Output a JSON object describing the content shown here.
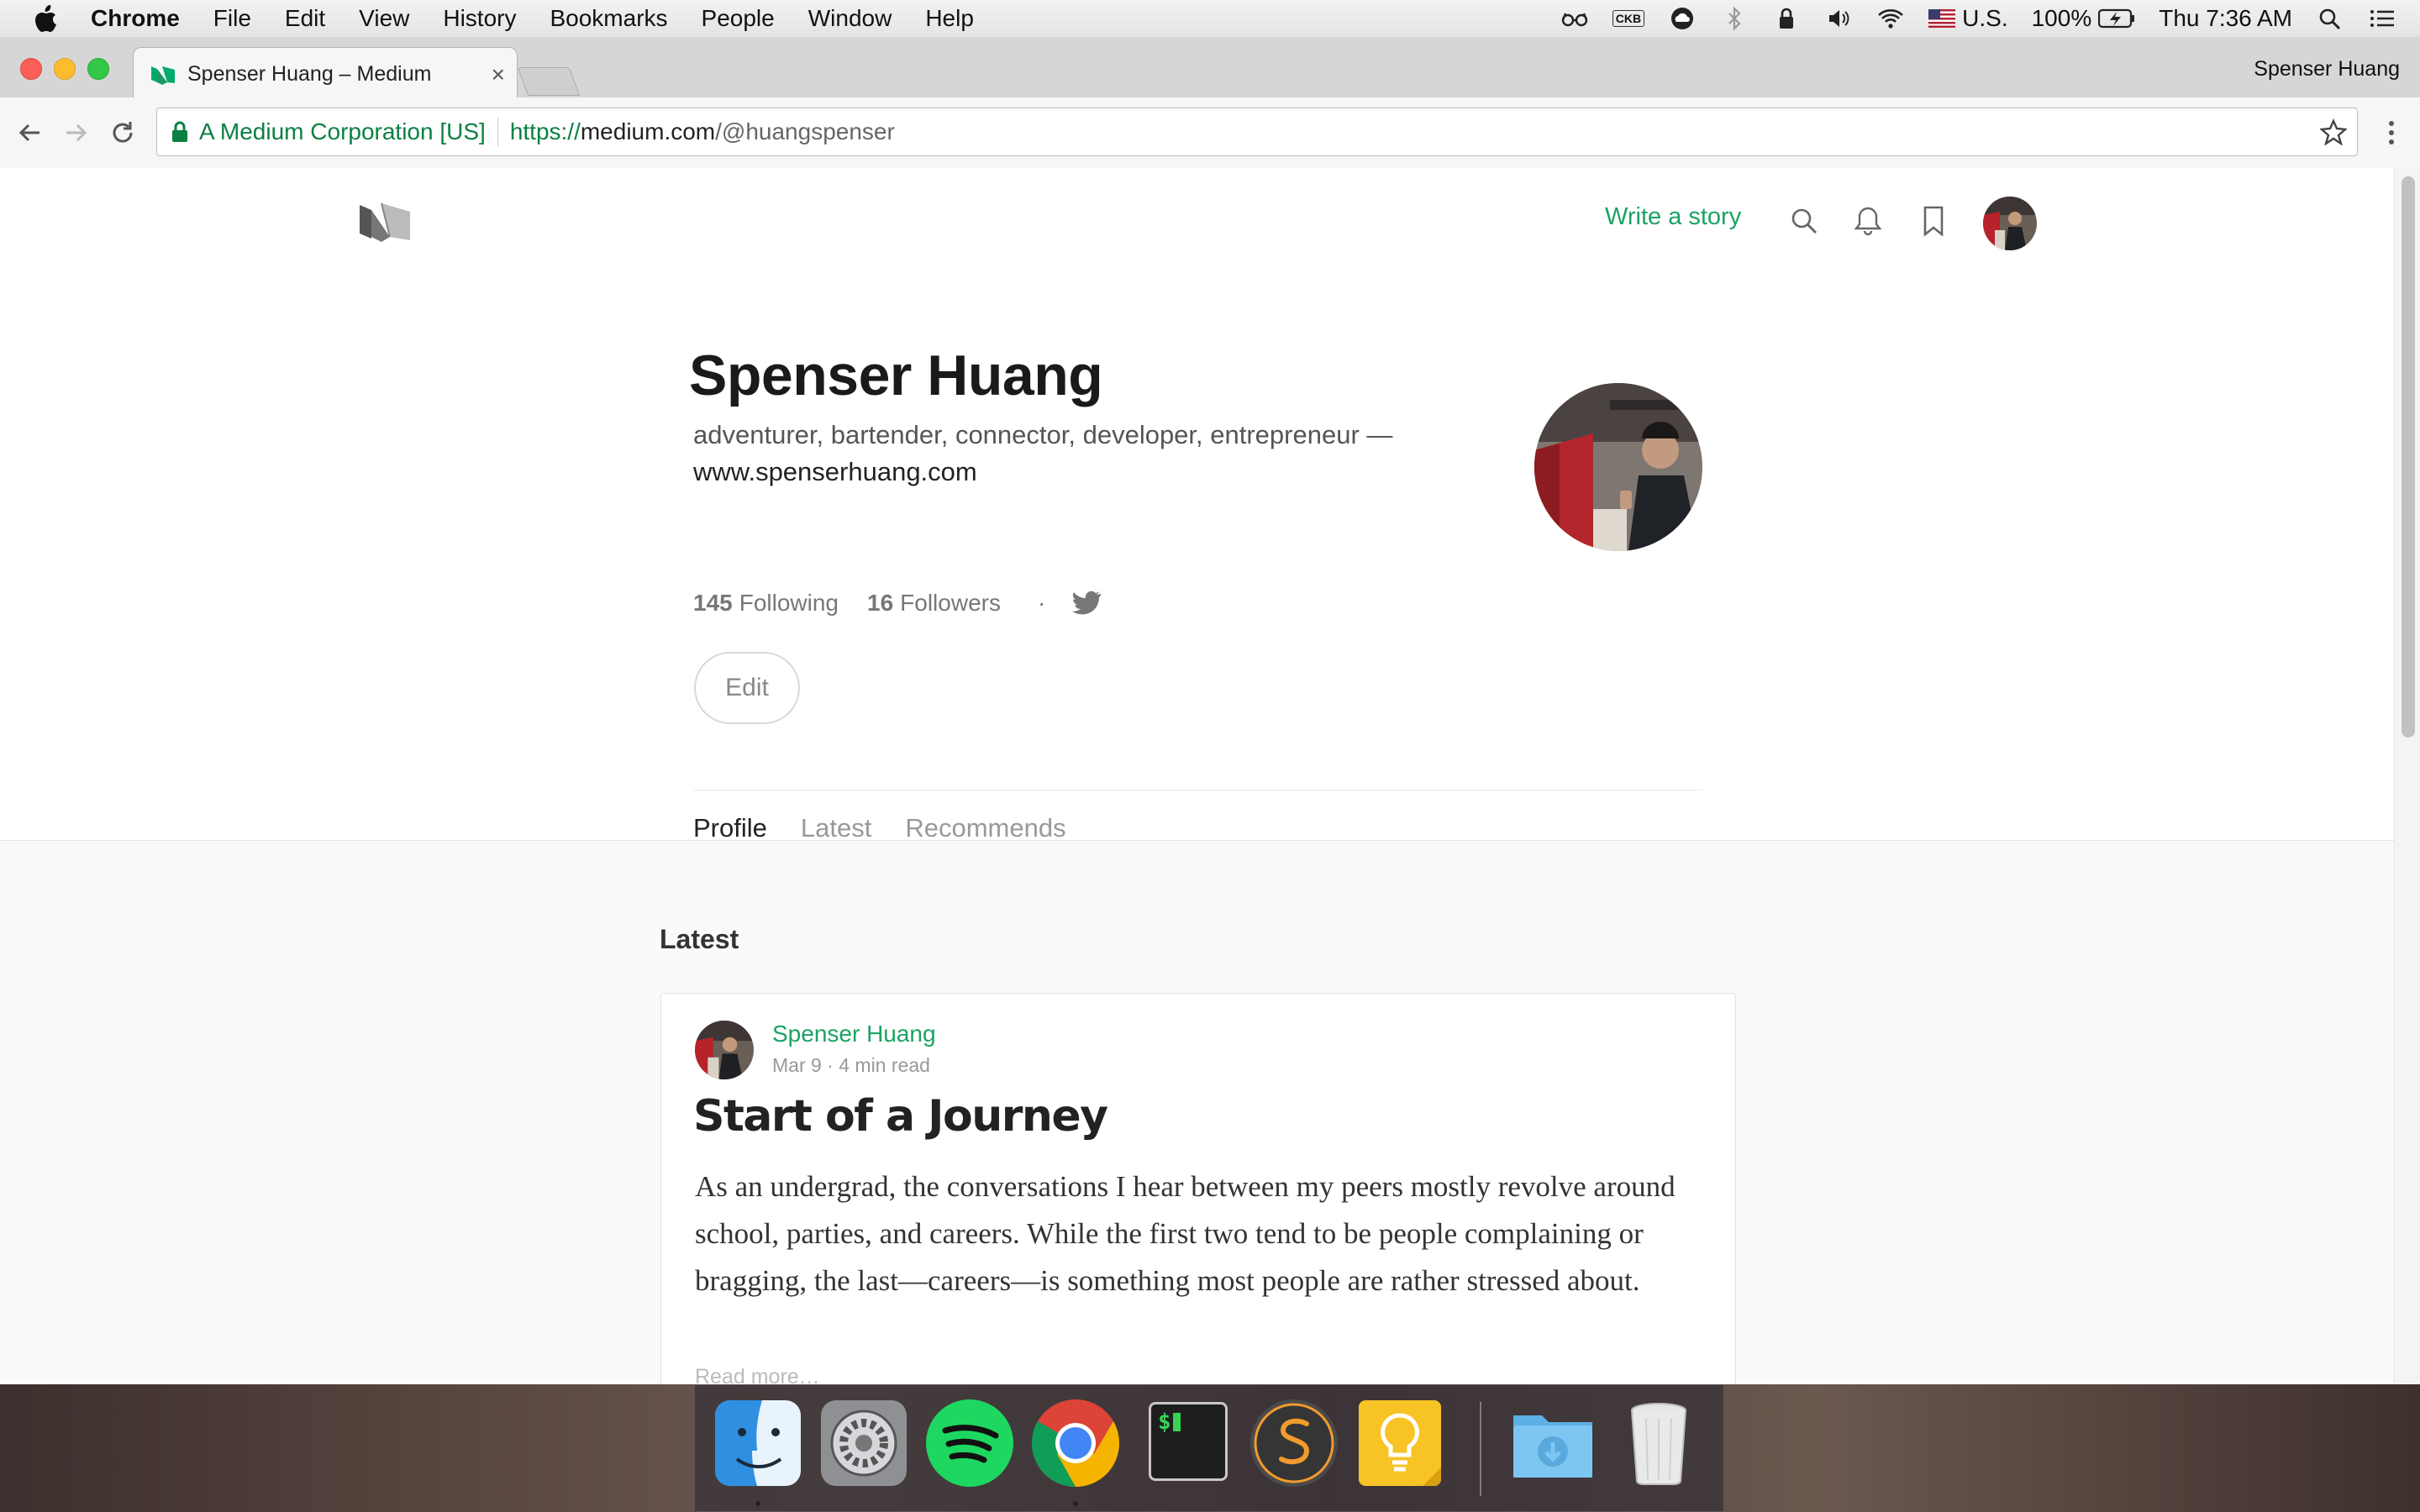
{
  "menubar": {
    "app": "Chrome",
    "items": [
      "File",
      "Edit",
      "View",
      "History",
      "Bookmarks",
      "People",
      "Window",
      "Help"
    ],
    "status": {
      "input_source_badge": "CKB",
      "keyboard_region": "U.S.",
      "battery": "100%",
      "clock": "Thu 7:36 AM"
    }
  },
  "browser": {
    "tab_title": "Spenser Huang – Medium",
    "tab_close": "×",
    "profile_name": "Spenser Huang",
    "omnibox": {
      "org": "A Medium Corporation [US]",
      "scheme": "https://",
      "host": "medium.com",
      "path": "/@huangspenser"
    }
  },
  "page": {
    "header": {
      "write_story": "Write a story"
    },
    "profile": {
      "name": "Spenser Huang",
      "bio": "adventurer, bartender, connector, developer, entrepreneur —",
      "website": "www.spenserhuang.com",
      "following_count": "145",
      "following_label": "Following",
      "followers_count": "16",
      "followers_label": "Followers",
      "separator": "·",
      "edit_label": "Edit"
    },
    "tabs": [
      "Profile",
      "Latest",
      "Recommends"
    ],
    "section_title": "Latest",
    "post": {
      "author": "Spenser Huang",
      "meta": "Mar 9 · 4 min read",
      "title": "Start of a Journey",
      "excerpt": "As an undergrad, the conversations I hear between my peers mostly revolve around school, parties, and careers. While the first two tend to be people complaining or bragging, the last—careers—is something most people are rather stressed about.",
      "read_more": "Read more…"
    }
  },
  "dock": {
    "apps": [
      "finder-icon",
      "system-preferences-icon",
      "spotify-icon",
      "chrome-icon",
      "terminal-icon",
      "sublime-text-icon",
      "keynote-icon",
      "downloads-folder-icon",
      "trash-icon"
    ],
    "terminal_prompt": "$"
  },
  "colors": {
    "medium_green": "#1aa363",
    "secure_green": "#0b8043",
    "text_dark": "#1a1a1a"
  }
}
